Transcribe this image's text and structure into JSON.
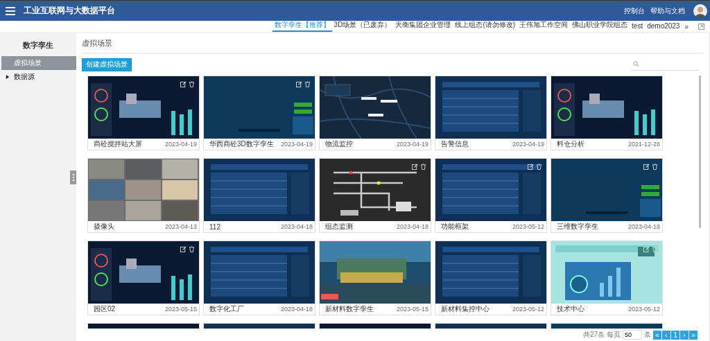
{
  "header": {
    "title": "工业互联网与大数据平台",
    "links": [
      "控制台",
      "帮助与文档"
    ]
  },
  "workspace_tabs": [
    {
      "label": "数字孪生【推荐】",
      "selected": true
    },
    {
      "label": "3D场景（已废弃）",
      "selected": false
    },
    {
      "label": "天衡集团企业管理",
      "selected": false
    },
    {
      "label": "线上组态(请勿修改)",
      "selected": false
    },
    {
      "label": "王伟旭工作空间",
      "selected": false
    },
    {
      "label": "佛山职业学院组态",
      "selected": false
    },
    {
      "label": "test",
      "selected": false
    },
    {
      "label": "demo2023",
      "selected": false
    }
  ],
  "tabs_more": "»",
  "sidebar": {
    "title": "数字孪生",
    "items": [
      {
        "label": "虚拟场景",
        "selected": true,
        "kind": "leaf"
      },
      {
        "label": "数据源",
        "selected": false,
        "kind": "folder",
        "expanded": false
      }
    ]
  },
  "main": {
    "title": "虚拟场景",
    "create_button": "创建虚拟场景"
  },
  "cards": [
    {
      "title": "商砼搅拌站大屏",
      "date": "2023-04-19",
      "actions": true,
      "kind": "dashboard"
    },
    {
      "title": "华西商砼3D数字孪生",
      "date": "2023-04-19",
      "actions": true,
      "kind": "blank"
    },
    {
      "title": "物流监控",
      "date": "2023-04-19",
      "actions": false,
      "kind": "map"
    },
    {
      "title": "告警信息",
      "date": "2023-04-19",
      "actions": false,
      "kind": "table"
    },
    {
      "title": "料仓分析",
      "date": "2021-12-28",
      "actions": false,
      "kind": "dashboard"
    },
    {
      "title": "摄像头",
      "date": "2023-04-13",
      "actions": false,
      "kind": "camera"
    },
    {
      "title": "112",
      "date": "2023-04-18",
      "actions": false,
      "kind": "table"
    },
    {
      "title": "组态监测",
      "date": "2023-04-18",
      "actions": true,
      "kind": "pipes"
    },
    {
      "title": "功能框架",
      "date": "2023-05-12",
      "actions": true,
      "kind": "table"
    },
    {
      "title": "三维数字孪生",
      "date": "2023-04-18",
      "actions": true,
      "kind": "blank"
    },
    {
      "title": "园区02",
      "date": "2023-05-15",
      "actions": true,
      "kind": "dashboard"
    },
    {
      "title": "数字化工厂",
      "date": "2023-04-18",
      "actions": false,
      "kind": "table"
    },
    {
      "title": "新材料数字孪生",
      "date": "2023-05-15",
      "actions": false,
      "kind": "scene"
    },
    {
      "title": "新材料集控中心",
      "date": "2023-05-12",
      "actions": false,
      "kind": "table"
    },
    {
      "title": "技术中心",
      "date": "2023-05-12",
      "actions": true,
      "kind": "light"
    },
    {
      "kind": "dashboard"
    },
    {
      "kind": "table"
    },
    {
      "kind": "dashboard"
    },
    {
      "kind": "table"
    },
    {
      "kind": "blank"
    }
  ],
  "pagination": {
    "total": "共27条",
    "per_page_label": "每页",
    "per_page": "50",
    "unit": "条",
    "buttons": [
      "«",
      "‹",
      "1",
      "›",
      "»"
    ]
  }
}
